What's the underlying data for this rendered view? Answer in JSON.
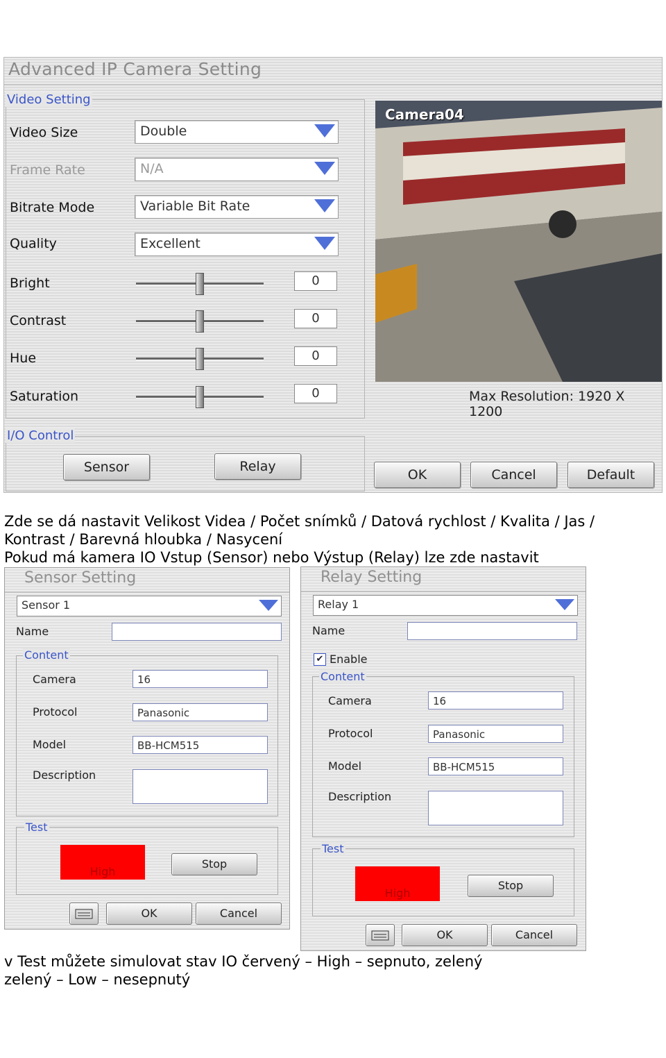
{
  "main_dialog": {
    "title": "Advanced IP Camera Setting",
    "video_setting": {
      "group_label": "Video Setting",
      "video_size": {
        "label": "Video Size",
        "value": "Double"
      },
      "frame_rate": {
        "label": "Frame Rate",
        "value": "N/A"
      },
      "bitrate_mode": {
        "label": "Bitrate Mode",
        "value": "Variable Bit Rate"
      },
      "quality": {
        "label": "Quality",
        "value": "Excellent"
      },
      "bright": {
        "label": "Bright",
        "value": "0"
      },
      "contrast": {
        "label": "Contrast",
        "value": "0"
      },
      "hue": {
        "label": "Hue",
        "value": "0"
      },
      "saturation": {
        "label": "Saturation",
        "value": "0"
      }
    },
    "camera_preview": {
      "label": "Camera04",
      "max_resolution": "Max Resolution: 1920 X 1200"
    },
    "io_control": {
      "group_label": "I/O Control",
      "sensor_button": "Sensor",
      "relay_button": "Relay"
    },
    "buttons": {
      "ok": "OK",
      "cancel": "Cancel",
      "default": "Default"
    }
  },
  "text": {
    "line1": "Zde se dá nastavit Velikost Videa / Počet snímků / Datová rychlost / Kvalita / Jas /",
    "line2": "Kontrast / Barevná hloubka / Nasycení",
    "line3": "Pokud má kamera IO Vstup (Sensor) nebo Výstup (Relay) lze zde nastavit",
    "line4": "v Test můžete simulovat stav IO červený – High – sepnuto, zelený",
    "line5": "zelený – Low – nesepnutý"
  },
  "sensor_setting": {
    "title": "Sensor Setting",
    "selector": "Sensor 1",
    "name_label": "Name",
    "name_value": "",
    "content_label": "Content",
    "camera_label": "Camera",
    "camera_value": "16",
    "protocol_label": "Protocol",
    "protocol_value": "Panasonic",
    "model_label": "Model",
    "model_value": "BB-HCM515",
    "description_label": "Description",
    "test_label": "Test",
    "state_label": "High",
    "stop_button": "Stop",
    "ok_button": "OK",
    "cancel_button": "Cancel",
    "state_color": "#ff0000"
  },
  "relay_setting": {
    "title": "Relay Setting",
    "selector": "Relay 1",
    "name_label": "Name",
    "name_value": "",
    "enable_label": "Enable",
    "enable_checked": true,
    "content_label": "Content",
    "camera_label": "Camera",
    "camera_value": "16",
    "protocol_label": "Protocol",
    "protocol_value": "Panasonic",
    "model_label": "Model",
    "model_value": "BB-HCM515",
    "description_label": "Description",
    "test_label": "Test",
    "state_label": "High",
    "stop_button": "Stop",
    "ok_button": "OK",
    "cancel_button": "Cancel",
    "state_color": "#ff0000"
  }
}
